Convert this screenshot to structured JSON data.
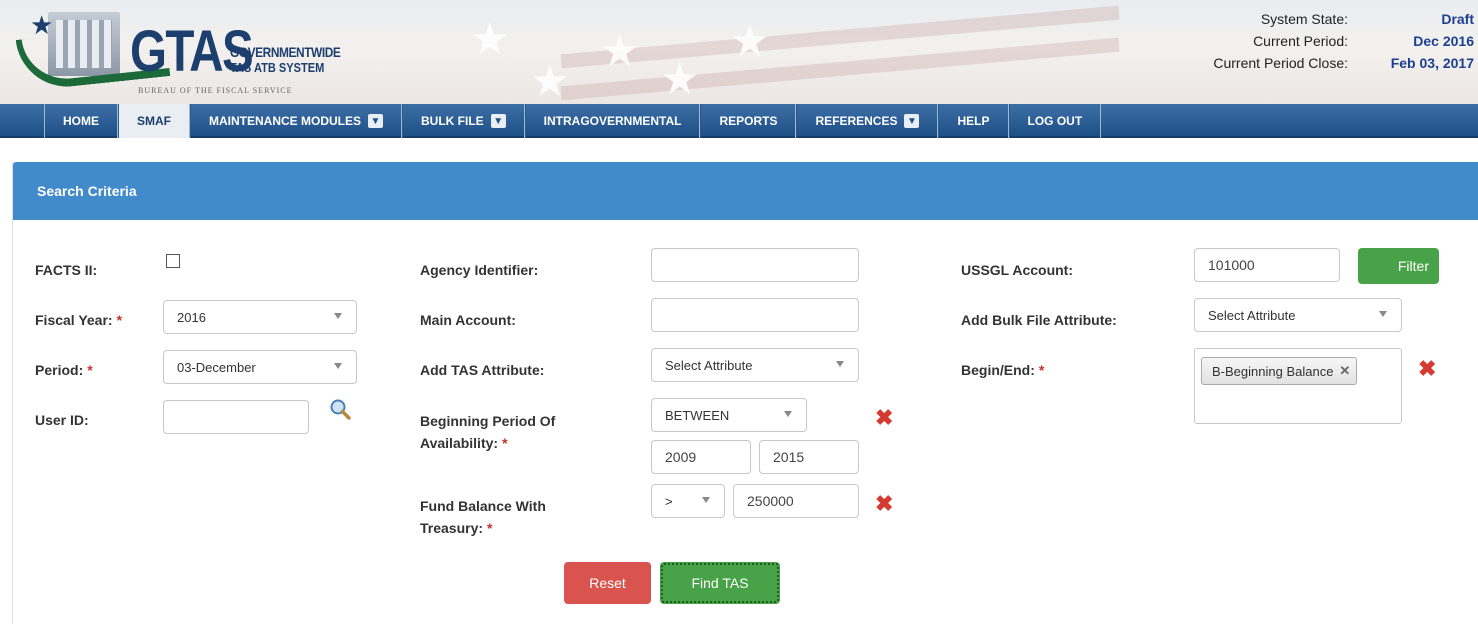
{
  "header": {
    "logo_text": "GTAS",
    "logo_subtitle_1": "GOVERNMENTWIDE",
    "logo_subtitle_2": "TAS ATB SYSTEM",
    "logo_bureau": "BUREAU OF THE FISCAL SERVICE",
    "system_state_label": "System State:",
    "system_state_value": "Draft",
    "current_period_label": "Current Period:",
    "current_period_value": "Dec 2016",
    "period_close_label": "Current Period Close:",
    "period_close_value": "Feb 03, 2017"
  },
  "nav": {
    "items": [
      {
        "label": "HOME",
        "dropdown": false
      },
      {
        "label": "SMAF",
        "dropdown": false,
        "active": true
      },
      {
        "label": "MAINTENANCE MODULES",
        "dropdown": true
      },
      {
        "label": "BULK FILE",
        "dropdown": true
      },
      {
        "label": "INTRAGOVERNMENTAL",
        "dropdown": false
      },
      {
        "label": "REPORTS",
        "dropdown": false
      },
      {
        "label": "REFERENCES",
        "dropdown": true
      },
      {
        "label": "HELP",
        "dropdown": false
      },
      {
        "label": "LOG OUT",
        "dropdown": false
      }
    ]
  },
  "panel": {
    "title": "Search Criteria"
  },
  "form": {
    "facts2_label": "FACTS II:",
    "fiscal_year_label": "Fiscal Year:",
    "fiscal_year_value": "2016",
    "period_label": "Period:",
    "period_value": "03-December",
    "user_id_label": "User ID:",
    "user_id_value": "",
    "agency_id_label": "Agency Identifier:",
    "agency_id_value": "",
    "main_account_label": "Main Account:",
    "main_account_value": "",
    "add_tas_attr_label": "Add TAS Attribute:",
    "add_tas_attr_value": "Select Attribute",
    "bpoa_label_1": "Beginning Period Of",
    "bpoa_label_2": "Availability:",
    "bpoa_operator": "BETWEEN",
    "bpoa_from": "2009",
    "bpoa_to": "2015",
    "fbwt_label_1": "Fund Balance With",
    "fbwt_label_2": "Treasury:",
    "fbwt_operator": ">",
    "fbwt_value": "250000",
    "ussgl_label": "USSGL Account:",
    "ussgl_value": "101000",
    "filter_button": "Filter",
    "add_bulk_attr_label": "Add Bulk File Attribute:",
    "add_bulk_attr_value": "Select Attribute",
    "begin_end_label": "Begin/End:",
    "begin_end_tag": "B-Beginning Balance",
    "required_marker": "*",
    "remove_glyph": "✖",
    "tag_remove_glyph": "✕",
    "reset_button": "Reset",
    "find_button": "Find TAS"
  },
  "colors": {
    "accent": "#428bca",
    "nav": "#1e4f86",
    "danger": "#d9534f",
    "success": "#48a247",
    "remove": "#d43a2f"
  }
}
